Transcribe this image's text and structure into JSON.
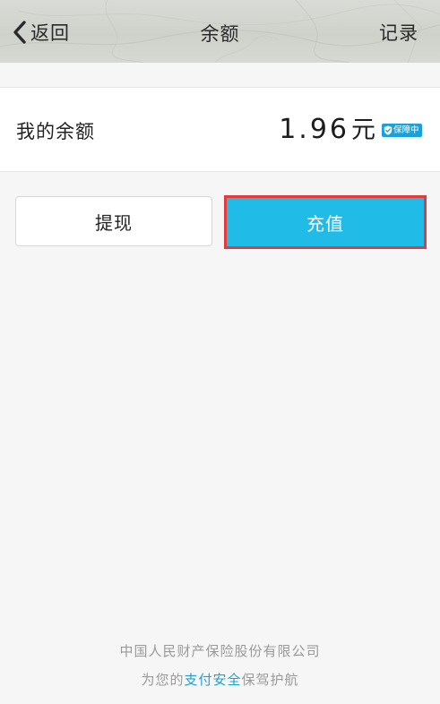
{
  "header": {
    "back_label": "返回",
    "title": "余额",
    "records_label": "记录"
  },
  "balance": {
    "label": "我的余额",
    "amount": "1.96",
    "unit": "元",
    "badge_text": "保障中"
  },
  "actions": {
    "withdraw_label": "提现",
    "recharge_label": "充值"
  },
  "footer": {
    "company": "中国人民财产保险股份有限公司",
    "slogan_prefix": "为您的",
    "slogan_highlight": "支付安全",
    "slogan_suffix": "保驾护航"
  },
  "colors": {
    "accent": "#21bbe8",
    "badge": "#1aa1d8",
    "highlight_border": "#e53a3a"
  },
  "icons": {
    "back": "chevron-left-icon",
    "badge": "shield-check-icon"
  }
}
